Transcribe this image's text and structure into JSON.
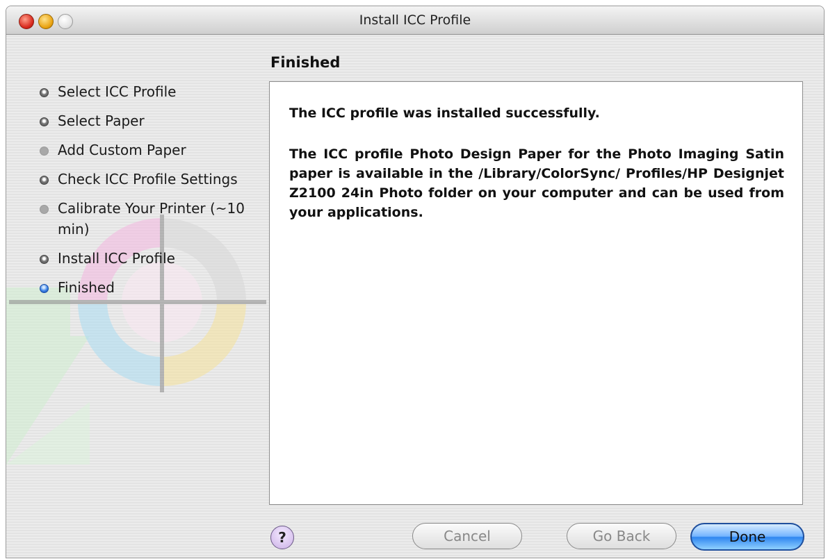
{
  "window": {
    "title": "Install ICC Profile"
  },
  "sidebar": {
    "steps": [
      {
        "label": "Select ICC Profile",
        "state": "done"
      },
      {
        "label": "Select Paper",
        "state": "done"
      },
      {
        "label": "Add Custom Paper",
        "state": "todo"
      },
      {
        "label": "Check ICC Profile Settings",
        "state": "done"
      },
      {
        "label": "Calibrate Your Printer (~10 min)",
        "state": "todo"
      },
      {
        "label": "Install ICC Profile",
        "state": "done"
      },
      {
        "label": "Finished",
        "state": "active"
      }
    ]
  },
  "main": {
    "heading": "Finished",
    "message_primary": "The ICC profile was installed successfully.",
    "message_detail": "The ICC profile Photo Design Paper for the Photo Imaging Satin paper is available in the /Library/ColorSync/ Profiles/HP Designjet Z2100 24in Photo folder on your computer and can be used from your applications."
  },
  "footer": {
    "help_label": "?",
    "cancel_label": "Cancel",
    "back_label": "Go Back",
    "done_label": "Done"
  },
  "colors": {
    "accent_blue": "#2f86f0",
    "close": "#d8281c",
    "minimize": "#e9a20f"
  },
  "icons": {
    "traffic_lights": [
      "close-icon",
      "minimize-icon",
      "zoom-icon"
    ],
    "decoration": "calibration-target-icon"
  }
}
